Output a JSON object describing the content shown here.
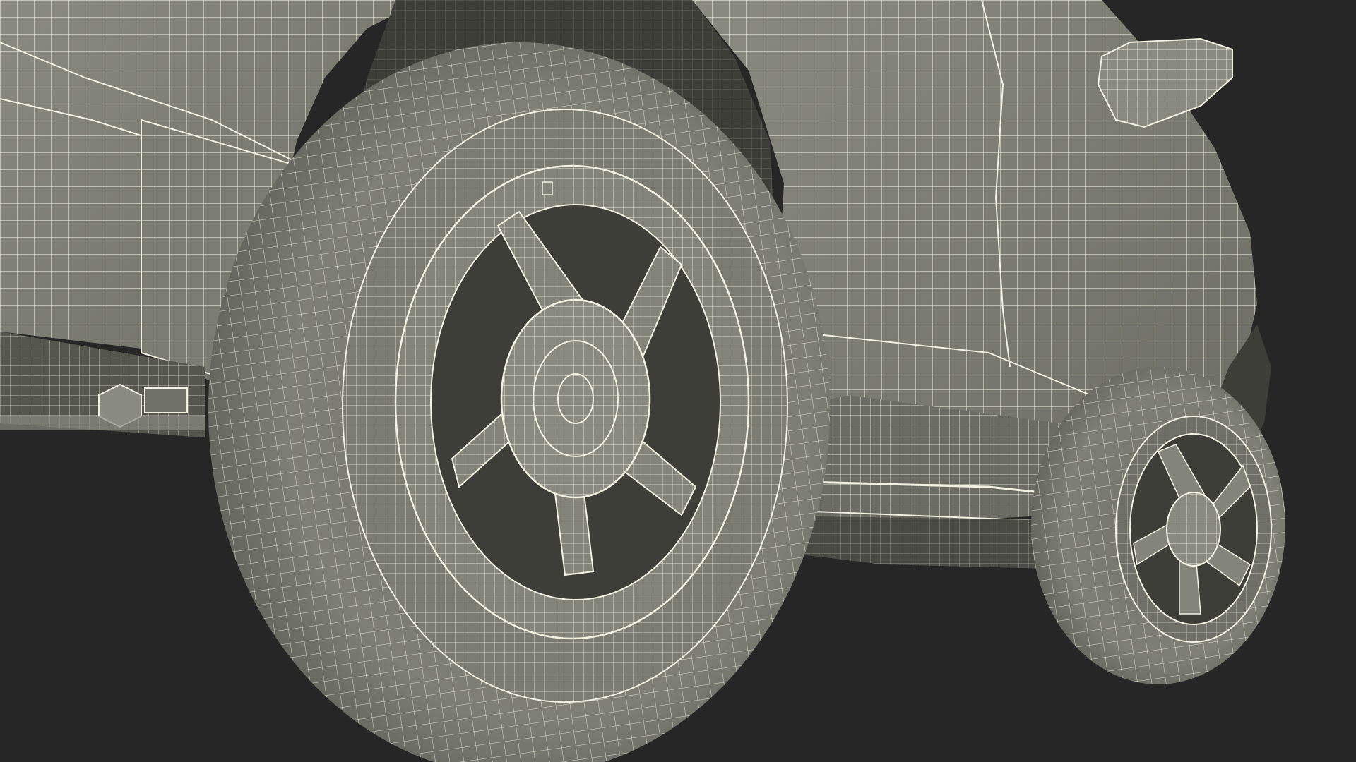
{
  "scene": {
    "subject": "wireframe-car-model",
    "background_color": "#262626",
    "surface_color": "#84857a",
    "surface_shadow_color": "#55564e",
    "surface_dark_color": "#3d3e38",
    "wire_color": "#f2f1e2"
  }
}
